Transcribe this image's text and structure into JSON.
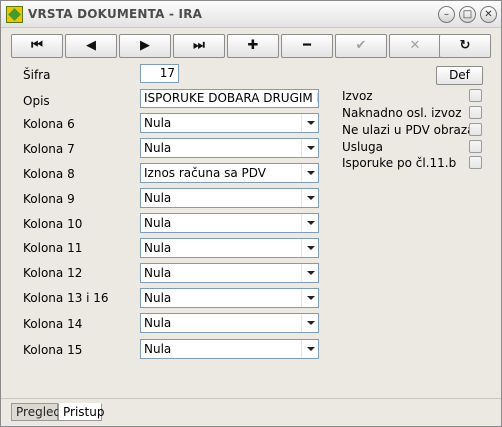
{
  "window": {
    "title": "VRSTA DOKUMENTA - IRA"
  },
  "toolbar": {
    "buttons": [
      {
        "name": "first-record-button",
        "glyph": "⏮"
      },
      {
        "name": "prev-record-button",
        "glyph": "◀"
      },
      {
        "name": "next-record-button",
        "glyph": "▶"
      },
      {
        "name": "last-record-button",
        "glyph": "⏭"
      },
      {
        "name": "add-button",
        "glyph": "✚"
      },
      {
        "name": "delete-button",
        "glyph": "━"
      },
      {
        "name": "confirm-button",
        "glyph": "✔"
      },
      {
        "name": "cancel-button",
        "glyph": "✕"
      },
      {
        "name": "refresh-button",
        "glyph": "↻"
      }
    ]
  },
  "form": {
    "sifra_label": "Šifra",
    "sifra_value": "17",
    "opis_label": "Opis",
    "opis_value": "ISPORUKE DOBARA DRUGIM DR.",
    "def_label": "Def",
    "columns": [
      {
        "label": "Kolona 6",
        "value": "Nula"
      },
      {
        "label": "Kolona 7",
        "value": "Nula"
      },
      {
        "label": "Kolona 8",
        "value": "Iznos računa sa PDV"
      },
      {
        "label": "Kolona 9",
        "value": "Nula"
      },
      {
        "label": "Kolona 10",
        "value": "Nula"
      },
      {
        "label": "Kolona 11",
        "value": "Nula"
      },
      {
        "label": "Kolona 12",
        "value": "Nula"
      },
      {
        "label": "Kolona 13 i 16",
        "value": "Nula"
      },
      {
        "label": "Kolona 14",
        "value": "Nula"
      },
      {
        "label": "Kolona 15",
        "value": "Nula"
      }
    ],
    "checkboxes": [
      {
        "label": "Izvoz",
        "checked": false
      },
      {
        "label": "Naknadno osl. izvoz",
        "checked": false
      },
      {
        "label": "Ne ulazi u PDV obrazac",
        "checked": false
      },
      {
        "label": "Usluga",
        "checked": false
      },
      {
        "label": "Isporuke po čl.11.b",
        "checked": false
      }
    ]
  },
  "tabs": [
    {
      "label": "Pregled",
      "active": false
    },
    {
      "label": "Pristup",
      "active": true
    }
  ],
  "colors": {
    "window_bg": "#ece9e2",
    "field_border": "#7f9db9",
    "dim_glyph": "#a3a3a3"
  }
}
